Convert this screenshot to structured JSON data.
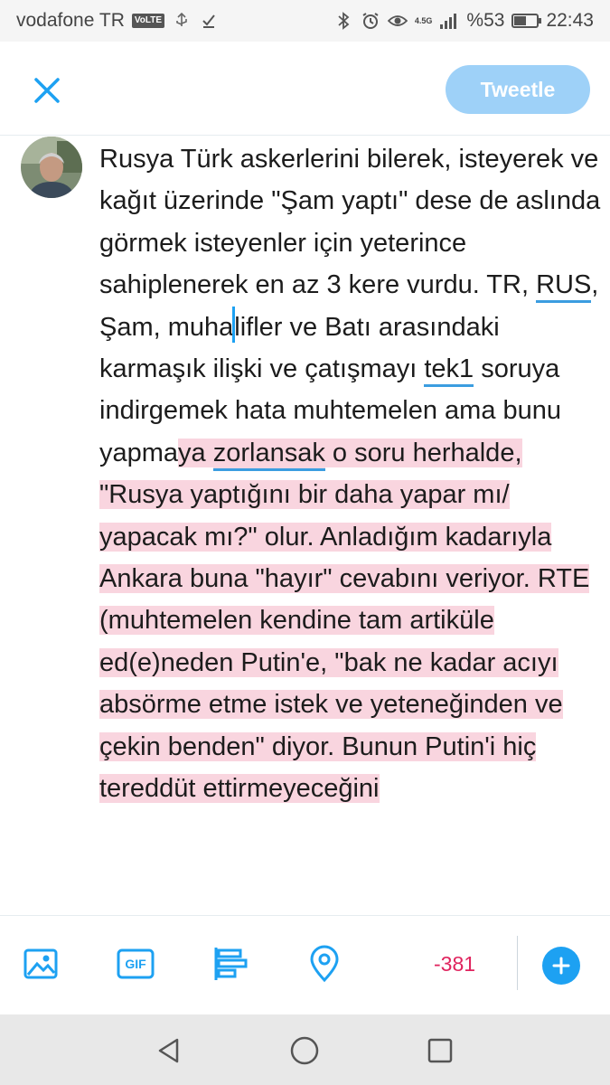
{
  "status_bar": {
    "carrier": "vodafone TR",
    "volte": "VoLTE",
    "network": "4.5G",
    "battery_text": "%53",
    "battery_level": 0.53,
    "time": "22:43"
  },
  "header": {
    "tweet_button": "Tweetle"
  },
  "compose": {
    "segments": [
      {
        "text": "Rusya Türk askerlerini bilerek, isteyerek ve kağıt üzerinde \"Şam yaptı\" dese de aslında görmek isteyenler için yeterince sahiplenerek en az 3 kere vurdu. TR, ",
        "style": "plain"
      },
      {
        "text": "RUS",
        "style": "underline"
      },
      {
        "text": ", Şam, muha",
        "style": "plain"
      },
      {
        "text": "lifler ve Batı arasındaki karmaşık ilişki ve çatışmayı ",
        "style": "plain"
      },
      {
        "text": "tek1",
        "style": "underline"
      },
      {
        "text": " soruya indirgemek hata muhtemelen ama bunu yapma",
        "style": "plain"
      },
      {
        "text": "ya ",
        "style": "highlight"
      },
      {
        "text": "zorlansak",
        "style": "highlight-underline"
      },
      {
        "text": " o soru herhalde, \"Rusya yaptığını bir daha yapar mı/ yapacak mı?\" olur. Anladığım kadarıyla Ankara buna \"hayır\" cevabını veriyor. RTE (muhtemelen kendine tam artiküle ed(e)neden Putin'e, \"bak ne kadar acıyı absörme etme istek ve yeteneğinden ve çekin benden\" diyor. Bunun Putin'i hiç tereddüt ettirmeyeceğini",
        "style": "highlight"
      }
    ]
  },
  "toolbar": {
    "char_count": "-381",
    "icons": [
      "image-icon",
      "gif-icon",
      "poll-icon",
      "location-icon"
    ],
    "gif_label": "GIF"
  },
  "colors": {
    "accent": "#1da1f2",
    "tweet_button_bg": "#9ed1f8",
    "highlight": "#f9d5df",
    "count_red": "#e0245e"
  }
}
